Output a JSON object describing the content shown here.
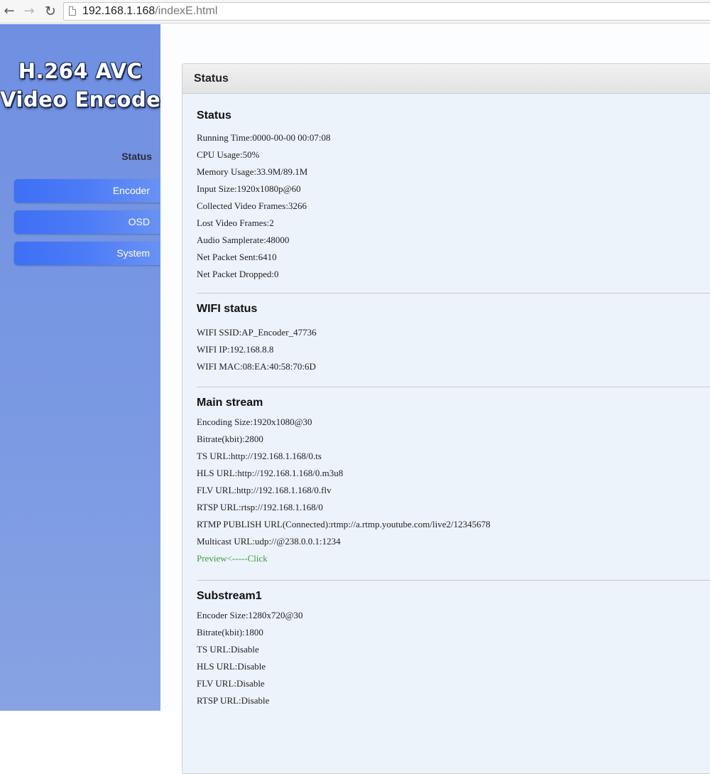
{
  "browser": {
    "url_host": "192.168.1.168",
    "url_path": "/indexE.html"
  },
  "sidebar": {
    "logo_line1": "H.264 AVC",
    "logo_line2": "Video Encoder",
    "status_label": "Status",
    "items": [
      {
        "label": "Encoder"
      },
      {
        "label": "OSD"
      },
      {
        "label": "System"
      }
    ]
  },
  "panel": {
    "header": "Status"
  },
  "status": {
    "title": "Status",
    "lines": [
      "Running Time:0000-00-00 00:07:08",
      "CPU Usage:50%",
      "Memory Usage:33.9M/89.1M",
      "Input Size:1920x1080p@60",
      "Collected Video Frames:3266",
      "Lost Video Frames:2",
      "Audio Samplerate:48000",
      "Net Packet Sent:6410",
      "Net Packet Dropped:0"
    ]
  },
  "wifi": {
    "title": "WIFI status",
    "lines": [
      "WIFI SSID:AP_Encoder_47736",
      "WIFI IP:192.168.8.8",
      "WIFI MAC:08:EA:40:58:70:6D"
    ]
  },
  "main_stream": {
    "title": "Main stream",
    "lines": [
      "Encoding Size:1920x1080@30",
      "Bitrate(kbit):2800",
      "TS URL:http://192.168.1.168/0.ts",
      "HLS URL:http://192.168.1.168/0.m3u8",
      "FLV URL:http://192.168.1.168/0.flv",
      "RTSP URL:rtsp://192.168.1.168/0",
      "RTMP PUBLISH URL(Connected):rtmp://a.rtmp.youtube.com/live2/12345678",
      "Multicast URL:udp://@238.0.0.1:1234"
    ],
    "preview": "Preview<-----Click"
  },
  "substream1": {
    "title": "Substream1",
    "lines": [
      "Encoder Size:1280x720@30",
      "Bitrate(kbit):1800",
      "TS URL:Disable",
      "HLS URL:Disable",
      "FLV URL:Disable",
      "RTSP URL:Disable"
    ]
  }
}
